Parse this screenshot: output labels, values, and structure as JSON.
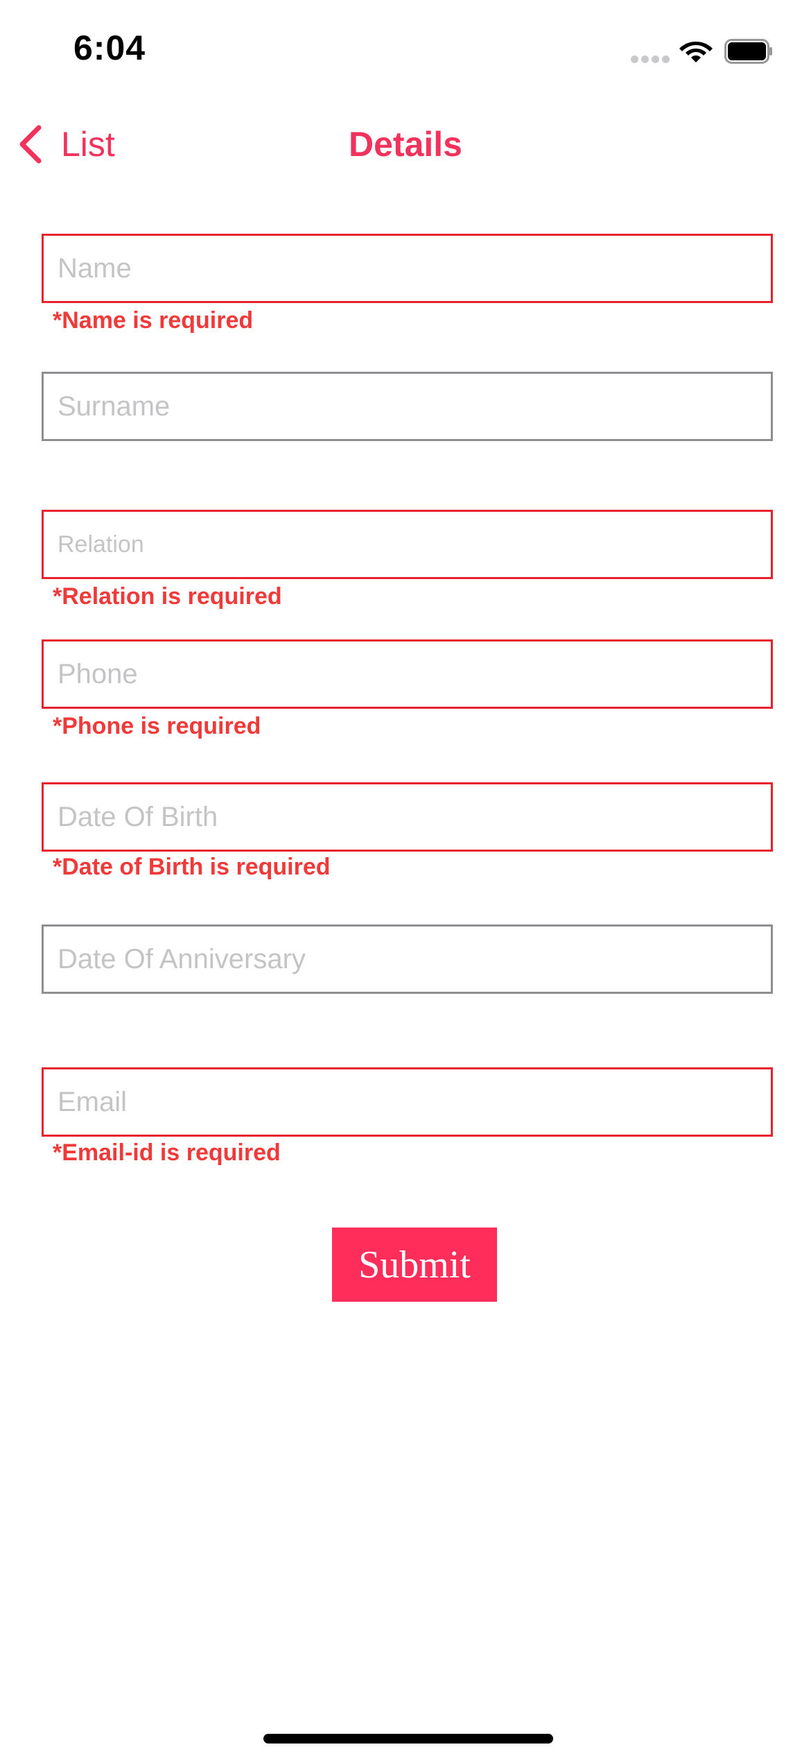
{
  "status_bar": {
    "time": "6:04"
  },
  "nav": {
    "back_label": "List",
    "title": "Details"
  },
  "form": {
    "name": {
      "placeholder": "Name",
      "value": "",
      "error": "*Name is required"
    },
    "surname": {
      "placeholder": "Surname",
      "value": ""
    },
    "relation": {
      "placeholder": "Relation",
      "value": "",
      "error": "*Relation is required"
    },
    "phone": {
      "placeholder": "Phone",
      "value": "",
      "error": "*Phone is required"
    },
    "dob": {
      "placeholder": "Date Of Birth",
      "value": "",
      "error": "*Date of Birth is required"
    },
    "anniversary": {
      "placeholder": "Date Of Anniversary",
      "value": ""
    },
    "email": {
      "placeholder": "Email",
      "value": "",
      "error": "*Email-id is required"
    },
    "submit_label": "Submit"
  },
  "colors": {
    "accent": "#f0325c",
    "submit_bg": "#ff2d5a",
    "error": "#f03a3a",
    "error_border": "#e8212f",
    "field_border": "#8e8e93"
  },
  "icons": {
    "back": "chevron-left-icon",
    "signal": "cellular-signal-icon",
    "wifi": "wifi-icon",
    "battery": "battery-icon"
  }
}
